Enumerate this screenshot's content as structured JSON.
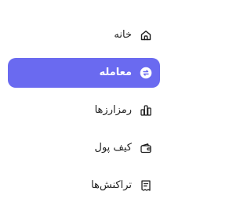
{
  "sidebar": {
    "active_color": "#6a6af0",
    "items": [
      {
        "label": "خانه",
        "icon": "home-icon",
        "active": false
      },
      {
        "label": "معامله",
        "icon": "exchange-icon",
        "active": true
      },
      {
        "label": "رمزارزها",
        "icon": "bar-chart-icon",
        "active": false
      },
      {
        "label": "کیف پول",
        "icon": "wallet-icon",
        "active": false
      },
      {
        "label": "تراکنش‌ها",
        "icon": "receipt-icon",
        "active": false
      }
    ]
  }
}
